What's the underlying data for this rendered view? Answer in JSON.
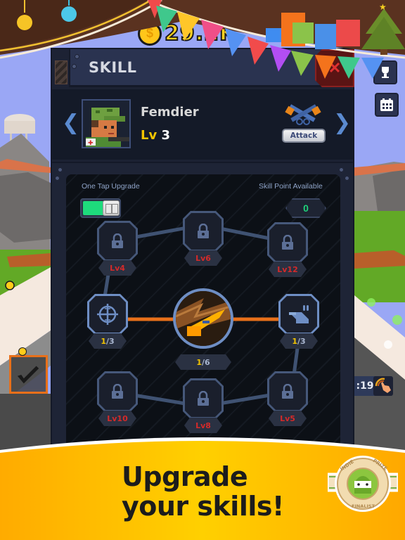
{
  "hud": {
    "coin_amount": "29.2K",
    "coin_icon": "dollar-coin-icon",
    "side_buttons": [
      {
        "icon": "trophy-icon"
      },
      {
        "icon": "calendar-icon"
      }
    ],
    "timer_text": ":19",
    "tap_hint_icon": "tap-hand-icon"
  },
  "panel": {
    "title": "SKILL",
    "close_icon": "close-icon",
    "character": {
      "name": "Femdier",
      "level_prefix": "Lv",
      "level": "3",
      "class_label": "Attack",
      "class_icon": "crossed-guns-icon",
      "prev_icon": "chevron-left-icon",
      "next_icon": "chevron-right-icon"
    },
    "tree": {
      "one_tap_label": "One Tap Upgrade",
      "one_tap_on": true,
      "skill_point_label": "Skill Point Available",
      "skill_points": "0",
      "center_skill": {
        "icon": "bullet-trail-icon",
        "current": "1",
        "max": "6"
      },
      "side_skills": [
        {
          "icon": "crosshair-icon",
          "current": "1",
          "max": "3"
        },
        {
          "icon": "ammo-clip-icon",
          "current": "1",
          "max": "3"
        }
      ],
      "locked_skills": [
        {
          "requirement": "Lv4"
        },
        {
          "requirement": "Lv6"
        },
        {
          "requirement": "Lv12"
        },
        {
          "requirement": "Lv10"
        },
        {
          "requirement": "Lv8"
        },
        {
          "requirement": "Lv5"
        }
      ]
    }
  },
  "banner": {
    "line1": "Upgrade",
    "line2": "your skills!",
    "award_top_left": "INDIE",
    "award_top_right": "PRIZE",
    "award_bottom": "FINALIST"
  },
  "colors": {
    "accent_green": "#1edb7c",
    "level_yellow": "#f2c400",
    "locked_red": "#d42a2a",
    "active_link": "#e8701a",
    "banner_yellow": "#ffc61a"
  }
}
